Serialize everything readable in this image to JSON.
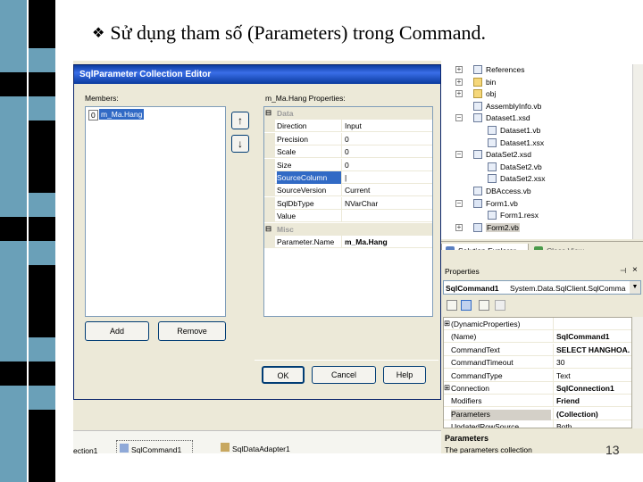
{
  "slide": {
    "title": "Sử dụng tham số (Parameters) trong Command.",
    "bullet": "❖",
    "page_number": "13"
  },
  "dialog": {
    "title": "SqlParameter Collection Editor",
    "members_label": "Members:",
    "members": [
      {
        "index": "0",
        "name": "m_Ma.Hang"
      }
    ],
    "properties_label": "m_Ma.Hang Properties:",
    "categories": [
      {
        "name": "Data",
        "toggle": "⊟",
        "rows": [
          {
            "name": "Direction",
            "value": "Input"
          },
          {
            "name": "Precision",
            "value": "0"
          },
          {
            "name": "Scale",
            "value": "0"
          },
          {
            "name": "Size",
            "value": "0"
          },
          {
            "name": "SourceColumn",
            "value": "|"
          },
          {
            "name": "SourceVersion",
            "value": "Current"
          },
          {
            "name": "SqlDbType",
            "value": "NVarChar"
          },
          {
            "name": "Value",
            "value": ""
          }
        ]
      },
      {
        "name": "Misc",
        "toggle": "⊟",
        "rows": [
          {
            "name": "Parameter.Name",
            "value": "m_Ma.Hang"
          }
        ]
      }
    ],
    "selected_row": "SourceColumn",
    "up_arrow": "↑",
    "down_arrow": "↓",
    "add_label": "Add",
    "remove_label": "Remove",
    "ok_label": "OK",
    "cancel_label": "Cancel",
    "help_label": "Help"
  },
  "solution_explorer": {
    "items": [
      {
        "label": "References",
        "expander": "+",
        "icon": "references-icon"
      },
      {
        "label": "bin",
        "expander": "+",
        "icon": "folder-icon"
      },
      {
        "label": "obj",
        "expander": "+",
        "icon": "folder-icon"
      },
      {
        "label": "AssemblyInfo.vb",
        "expander": "",
        "icon": "vb-file-icon"
      },
      {
        "label": "Dataset1.xsd",
        "expander": "−",
        "icon": "dataset-icon"
      },
      {
        "label": "Dataset1.vb",
        "expander": "",
        "icon": "vb-file-icon"
      },
      {
        "label": "Dataset1.xsx",
        "expander": "",
        "icon": "file-icon"
      },
      {
        "label": "DataSet2.xsd",
        "expander": "−",
        "icon": "dataset-icon"
      },
      {
        "label": "DataSet2.vb",
        "expander": "",
        "icon": "vb-file-icon"
      },
      {
        "label": "DataSet2.xsx",
        "expander": "",
        "icon": "file-icon"
      },
      {
        "label": "DBAccess.vb",
        "expander": "",
        "icon": "vb-file-icon"
      },
      {
        "label": "Form1.vb",
        "expander": "−",
        "icon": "form-icon"
      },
      {
        "label": "Form1.resx",
        "expander": "",
        "icon": "file-icon"
      },
      {
        "label": "Form2.vb",
        "expander": "+",
        "icon": "form-icon"
      }
    ],
    "tabs": [
      {
        "label": "Solution Explorer"
      },
      {
        "label": "Class View"
      }
    ]
  },
  "properties_window": {
    "title": "Properties",
    "pin": "⊣",
    "close": "×",
    "object_name": "SqlCommand1",
    "object_type": "System.Data.SqlClient.SqlComma",
    "rows": [
      {
        "name": "(DynamicProperties)",
        "value": "",
        "expander": "⊞"
      },
      {
        "name": "(Name)",
        "value": "SqlCommand1",
        "expander": ""
      },
      {
        "name": "CommandText",
        "value": "SELECT HANGHOA.",
        "expander": ""
      },
      {
        "name": "CommandTimeout",
        "value": "30",
        "expander": ""
      },
      {
        "name": "CommandType",
        "value": "Text",
        "expander": ""
      },
      {
        "name": "Connection",
        "value": "SqlConnection1",
        "expander": "⊞"
      },
      {
        "name": "Modifiers",
        "value": "Friend",
        "expander": ""
      },
      {
        "name": "Parameters",
        "value": "(Collection)",
        "expander": ""
      },
      {
        "name": "UpdatedRowSource",
        "value": "Both",
        "expander": ""
      }
    ],
    "description_title": "Parameters",
    "description_text": "The parameters collection"
  },
  "tray": {
    "items": [
      {
        "label": "ection1"
      },
      {
        "label": "SqlCommand1"
      },
      {
        "label": "SqlDataAdapter1"
      }
    ]
  }
}
